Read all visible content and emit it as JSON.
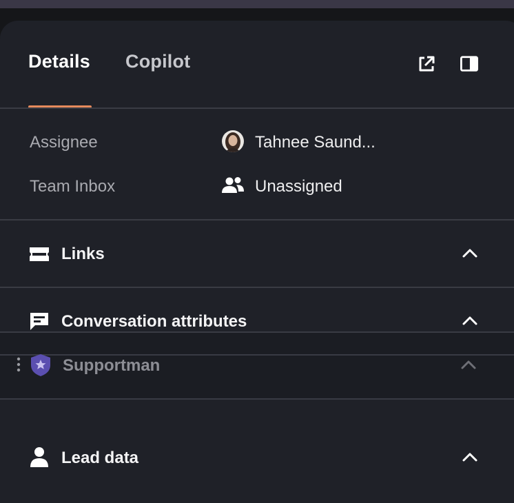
{
  "tabs": [
    {
      "label": "Details",
      "active": true
    },
    {
      "label": "Copilot",
      "active": false
    }
  ],
  "header_icons": [
    "external-link-icon",
    "sidebar-toggle-icon"
  ],
  "details": {
    "assignee_label": "Assignee",
    "assignee_value": "Tahnee Saund...",
    "team_inbox_label": "Team Inbox",
    "team_inbox_value": "Unassigned"
  },
  "sections": {
    "links": "Links",
    "conversation_attributes": "Conversation attributes",
    "supportman": "Supportman",
    "lead_data": "Lead data"
  },
  "colors": {
    "panel_bg": "#1f2128",
    "accent_underline": "#e68a5c",
    "supportman_shield": "#5b4fb0"
  }
}
